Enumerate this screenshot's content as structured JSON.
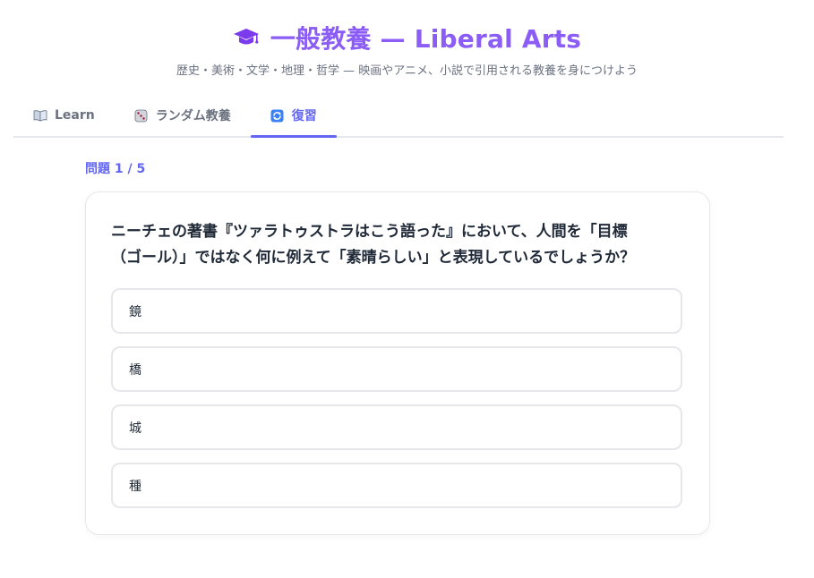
{
  "header": {
    "title": "一般教養 — Liberal Arts",
    "subtitle": "歴史・美術・文学・地理・哲学 — 映画やアニメ、小説で引用される教養を身につけよう",
    "icon": "graduation-cap-icon",
    "accent_color": "#8b5cf6"
  },
  "tabs": [
    {
      "label": "Learn",
      "icon": "book-icon",
      "active": false
    },
    {
      "label": "ランダム教養",
      "icon": "dice-icon",
      "active": false
    },
    {
      "label": "復習",
      "icon": "refresh-icon",
      "active": true
    }
  ],
  "quiz": {
    "counter": "問題 1 / 5",
    "question_line1": "ニーチェの著書『ツァラトゥストラはこう語った』において、人間を「目標",
    "question_line2": "（ゴール）」ではなく何に例えて「素晴らしい」と表現しているでしょうか？",
    "options": [
      "鏡",
      "橋",
      "城",
      "種"
    ]
  },
  "colors": {
    "accent": "#6366f1",
    "border": "#e5e7eb",
    "muted_text": "#6b7280"
  }
}
